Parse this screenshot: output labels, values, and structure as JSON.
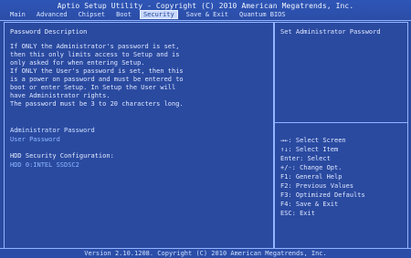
{
  "bios": {
    "title": "Aptio Setup Utility - Copyright (C) 2010 American Megatrends, Inc.",
    "tabs": [
      "Main",
      "Advanced",
      "Chipset",
      "Boot",
      "Security",
      "Save & Exit",
      "Quantum BIOS"
    ],
    "active_tab": "Security"
  },
  "left": {
    "password_description_title": "Password Description",
    "desc_lines": [
      "If ONLY the Administrator's password is set,",
      "then this only limits access to Setup and is",
      "only asked for when entering Setup.",
      "If ONLY the User's password is set, then this",
      "is a power on password and must be entered to",
      "boot or enter Setup. In Setup the User will",
      "have Administrator rights.",
      "The password must be 3 to 20 characters long."
    ],
    "items": [
      "Administrator Password",
      "User Password"
    ],
    "hdd_section_title": "HDD Security Configuration:",
    "hdd_item": "HDD 0:INTEL SSDSC2"
  },
  "right": {
    "help_title": "Set Administrator Password",
    "keys": [
      "→←: Select Screen",
      "↑↓: Select Item",
      "Enter: Select",
      "+/-: Change Opt.",
      "F1: General Help",
      "F2: Previous Values",
      "F3: Optimized Defaults",
      "F4: Save & Exit",
      "ESC: Exit"
    ]
  },
  "footer": "Version 2.10.1208. Copyright (C) 2010 American Megatrends, Inc.",
  "colors": {
    "bg": "#2a4aa0",
    "border": "#93b4ff",
    "active_tab_bg": "#c7d8ff",
    "text": "#dfe7ff"
  }
}
